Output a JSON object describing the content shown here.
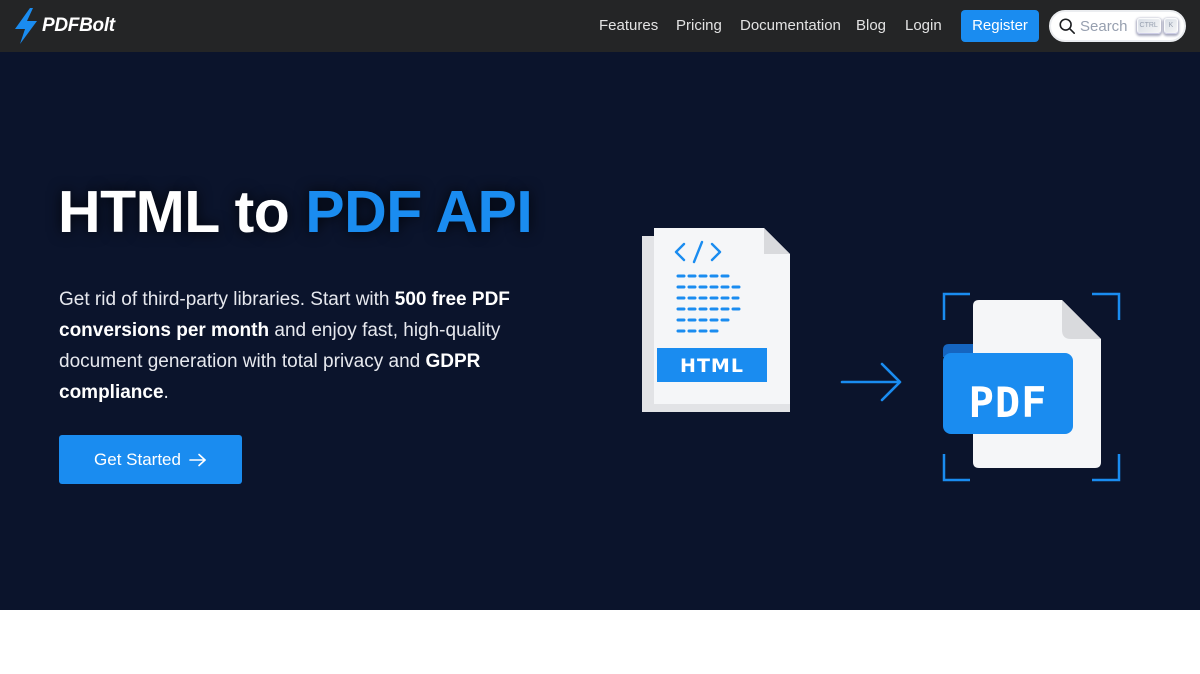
{
  "brand": {
    "name": "PDFBolt",
    "logo_icon": "lightning-bolt-icon"
  },
  "nav": {
    "links": [
      "Features",
      "Pricing",
      "Documentation",
      "Blog",
      "Login"
    ],
    "register_label": "Register",
    "search": {
      "placeholder": "Search",
      "shortcut": [
        "CTRL",
        "K"
      ]
    }
  },
  "hero": {
    "title_plain": "HTML to ",
    "title_accent": "PDF API",
    "desc": {
      "p1": "Get rid of third-party libraries. Start with ",
      "b1": "500 free PDF conversions per month",
      "p2": " and enjoy fast, high-quality document generation with total privacy and ",
      "b2": "GDPR compliance",
      "p3": "."
    },
    "cta_label": "Get Started",
    "cta_icon": "arrow-right-icon"
  },
  "illustration": {
    "source_label": "HTML",
    "target_label": "PDF",
    "source_icon": "code-icon",
    "arrow_icon": "arrow-right-icon"
  },
  "colors": {
    "nav_bg": "#242526",
    "hero_bg": "#0b142c",
    "accent": "#1a8cf0"
  }
}
